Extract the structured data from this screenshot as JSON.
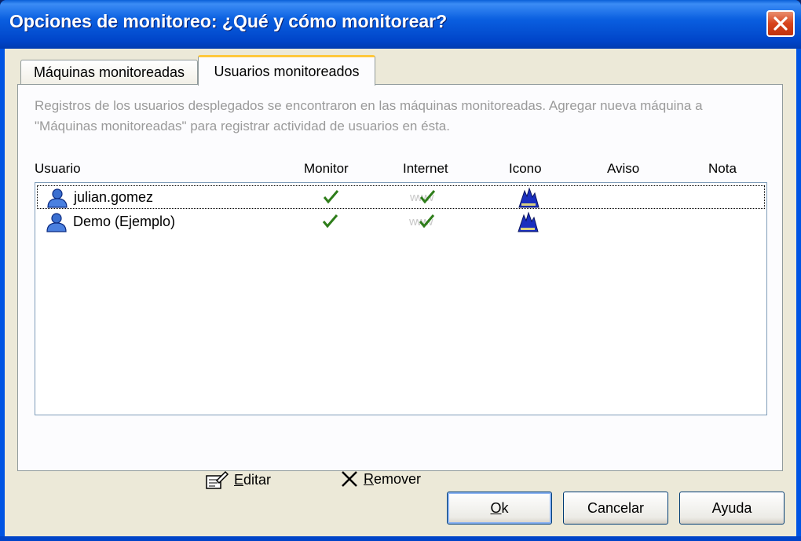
{
  "window": {
    "title": "Opciones de monitoreo: ¿Qué y cómo monitorear?",
    "close_icon": "close-icon"
  },
  "tabs": [
    {
      "label": "Máquinas monitoreadas",
      "active": false
    },
    {
      "label": "Usuarios monitoreados",
      "active": true
    }
  ],
  "description": "Registros de los usuarios desplegados se encontraron en las máquinas monitoreadas. Agregar nueva máquina a  \"Máquinas monitoreadas\" para registrar actividad de usuarios en ésta.",
  "columns": [
    "Usuario",
    "Monitor",
    "Internet",
    "Icono",
    "Aviso",
    "Nota"
  ],
  "users": [
    {
      "name": "julian.gomez",
      "monitor": "checked",
      "internet": "www-checked",
      "icon": "alert-icon",
      "focused": true
    },
    {
      "name": "Demo (Ejemplo)",
      "monitor": "checked",
      "internet": "www-checked",
      "icon": "alert-icon",
      "focused": false
    }
  ],
  "actions": {
    "edit": {
      "mnemonic": "E",
      "rest": "ditar",
      "icon": "edit-icon"
    },
    "remove": {
      "mnemonic": "R",
      "rest": "emover",
      "icon": "x-icon"
    }
  },
  "buttons": {
    "ok": {
      "mnemonic": "O",
      "rest": "k"
    },
    "cancel": "Cancelar",
    "help": "Ayuda"
  },
  "colors": {
    "title_bar": "#0054e3",
    "dialog_bg": "#ece9d8",
    "active_tab_accent": "#ffc83c",
    "check": "#2e7d1a",
    "alert_icon": "#1a2fbf"
  }
}
